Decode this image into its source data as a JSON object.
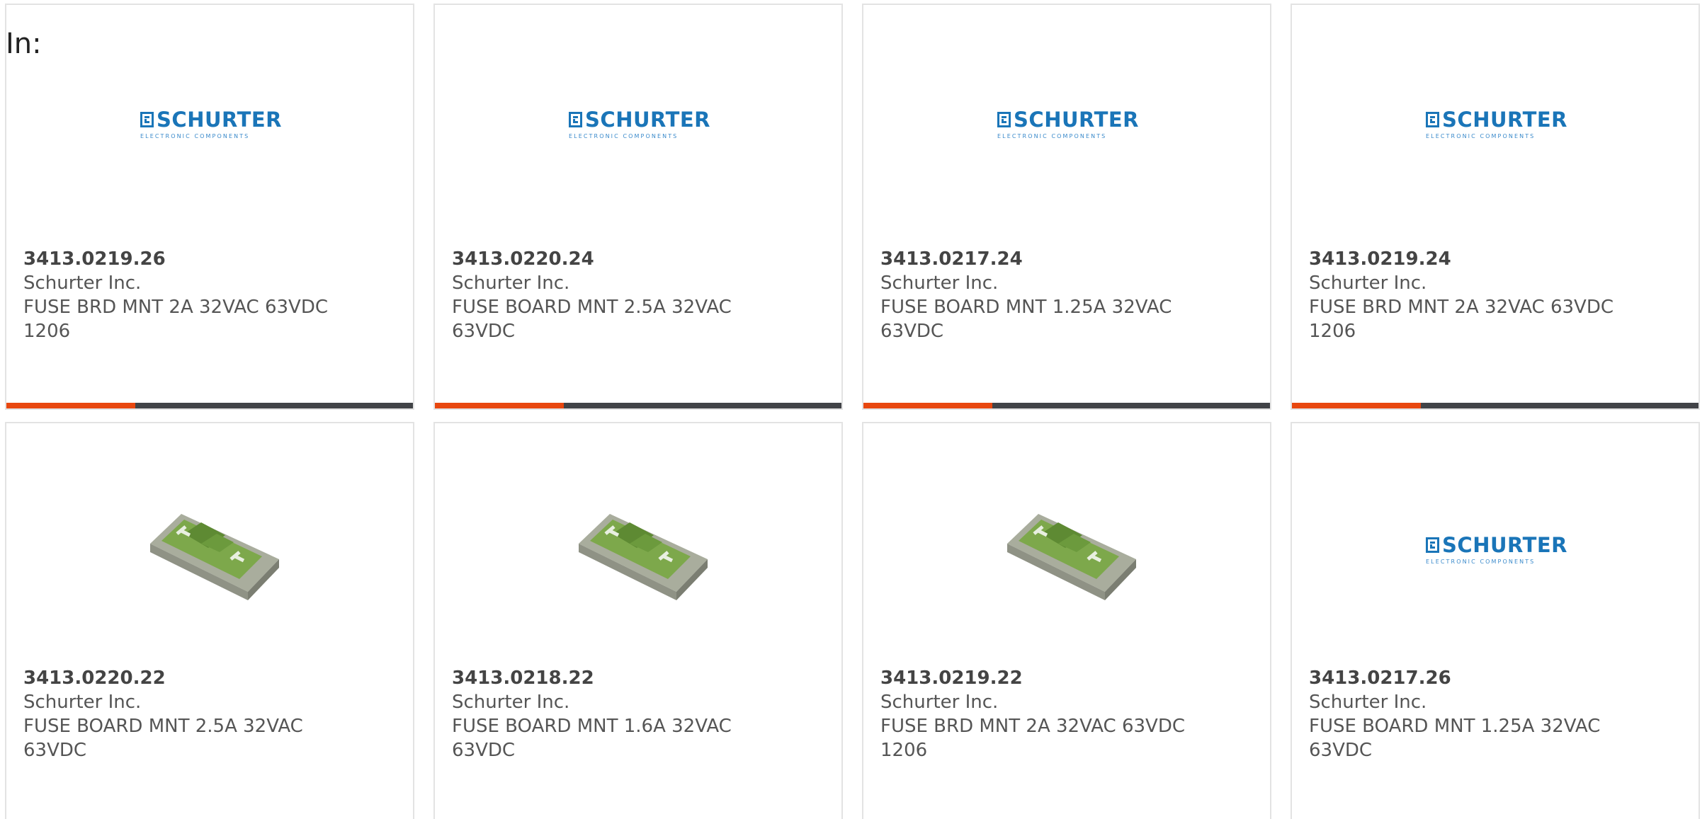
{
  "filter": {
    "label": "In:"
  },
  "brand": {
    "logo_word": "SCHURTER",
    "logo_sub": "ELECTRONIC COMPONENTS",
    "logo_color": "#1a75b8"
  },
  "colors": {
    "accent_bar": "#e8470f",
    "bar_dark": "#414347",
    "card_border": "#e3e3e3"
  },
  "products": [
    {
      "part_number": "3413.0219.26",
      "manufacturer": "Schurter Inc.",
      "description": "FUSE BRD MNT 2A 32VAC 63VDC 1206",
      "image": "schurter-logo"
    },
    {
      "part_number": "3413.0220.24",
      "manufacturer": "Schurter Inc.",
      "description": "FUSE BOARD MNT 2.5A 32VAC 63VDC",
      "image": "schurter-logo"
    },
    {
      "part_number": "3413.0217.24",
      "manufacturer": "Schurter Inc.",
      "description": "FUSE BOARD MNT 1.25A 32VAC 63VDC",
      "image": "schurter-logo"
    },
    {
      "part_number": "3413.0219.24",
      "manufacturer": "Schurter Inc.",
      "description": "FUSE BRD MNT 2A 32VAC 63VDC 1206",
      "image": "schurter-logo"
    },
    {
      "part_number": "3413.0220.22",
      "manufacturer": "Schurter Inc.",
      "description": "FUSE BOARD MNT 2.5A 32VAC 63VDC",
      "image": "smd-fuse-photo"
    },
    {
      "part_number": "3413.0218.22",
      "manufacturer": "Schurter Inc.",
      "description": "FUSE BOARD MNT 1.6A 32VAC 63VDC",
      "image": "smd-fuse-photo"
    },
    {
      "part_number": "3413.0219.22",
      "manufacturer": "Schurter Inc.",
      "description": "FUSE BRD MNT 2A 32VAC 63VDC 1206",
      "image": "smd-fuse-photo"
    },
    {
      "part_number": "3413.0217.26",
      "manufacturer": "Schurter Inc.",
      "description": "FUSE BOARD MNT 1.25A 32VAC 63VDC",
      "image": "schurter-logo"
    }
  ]
}
